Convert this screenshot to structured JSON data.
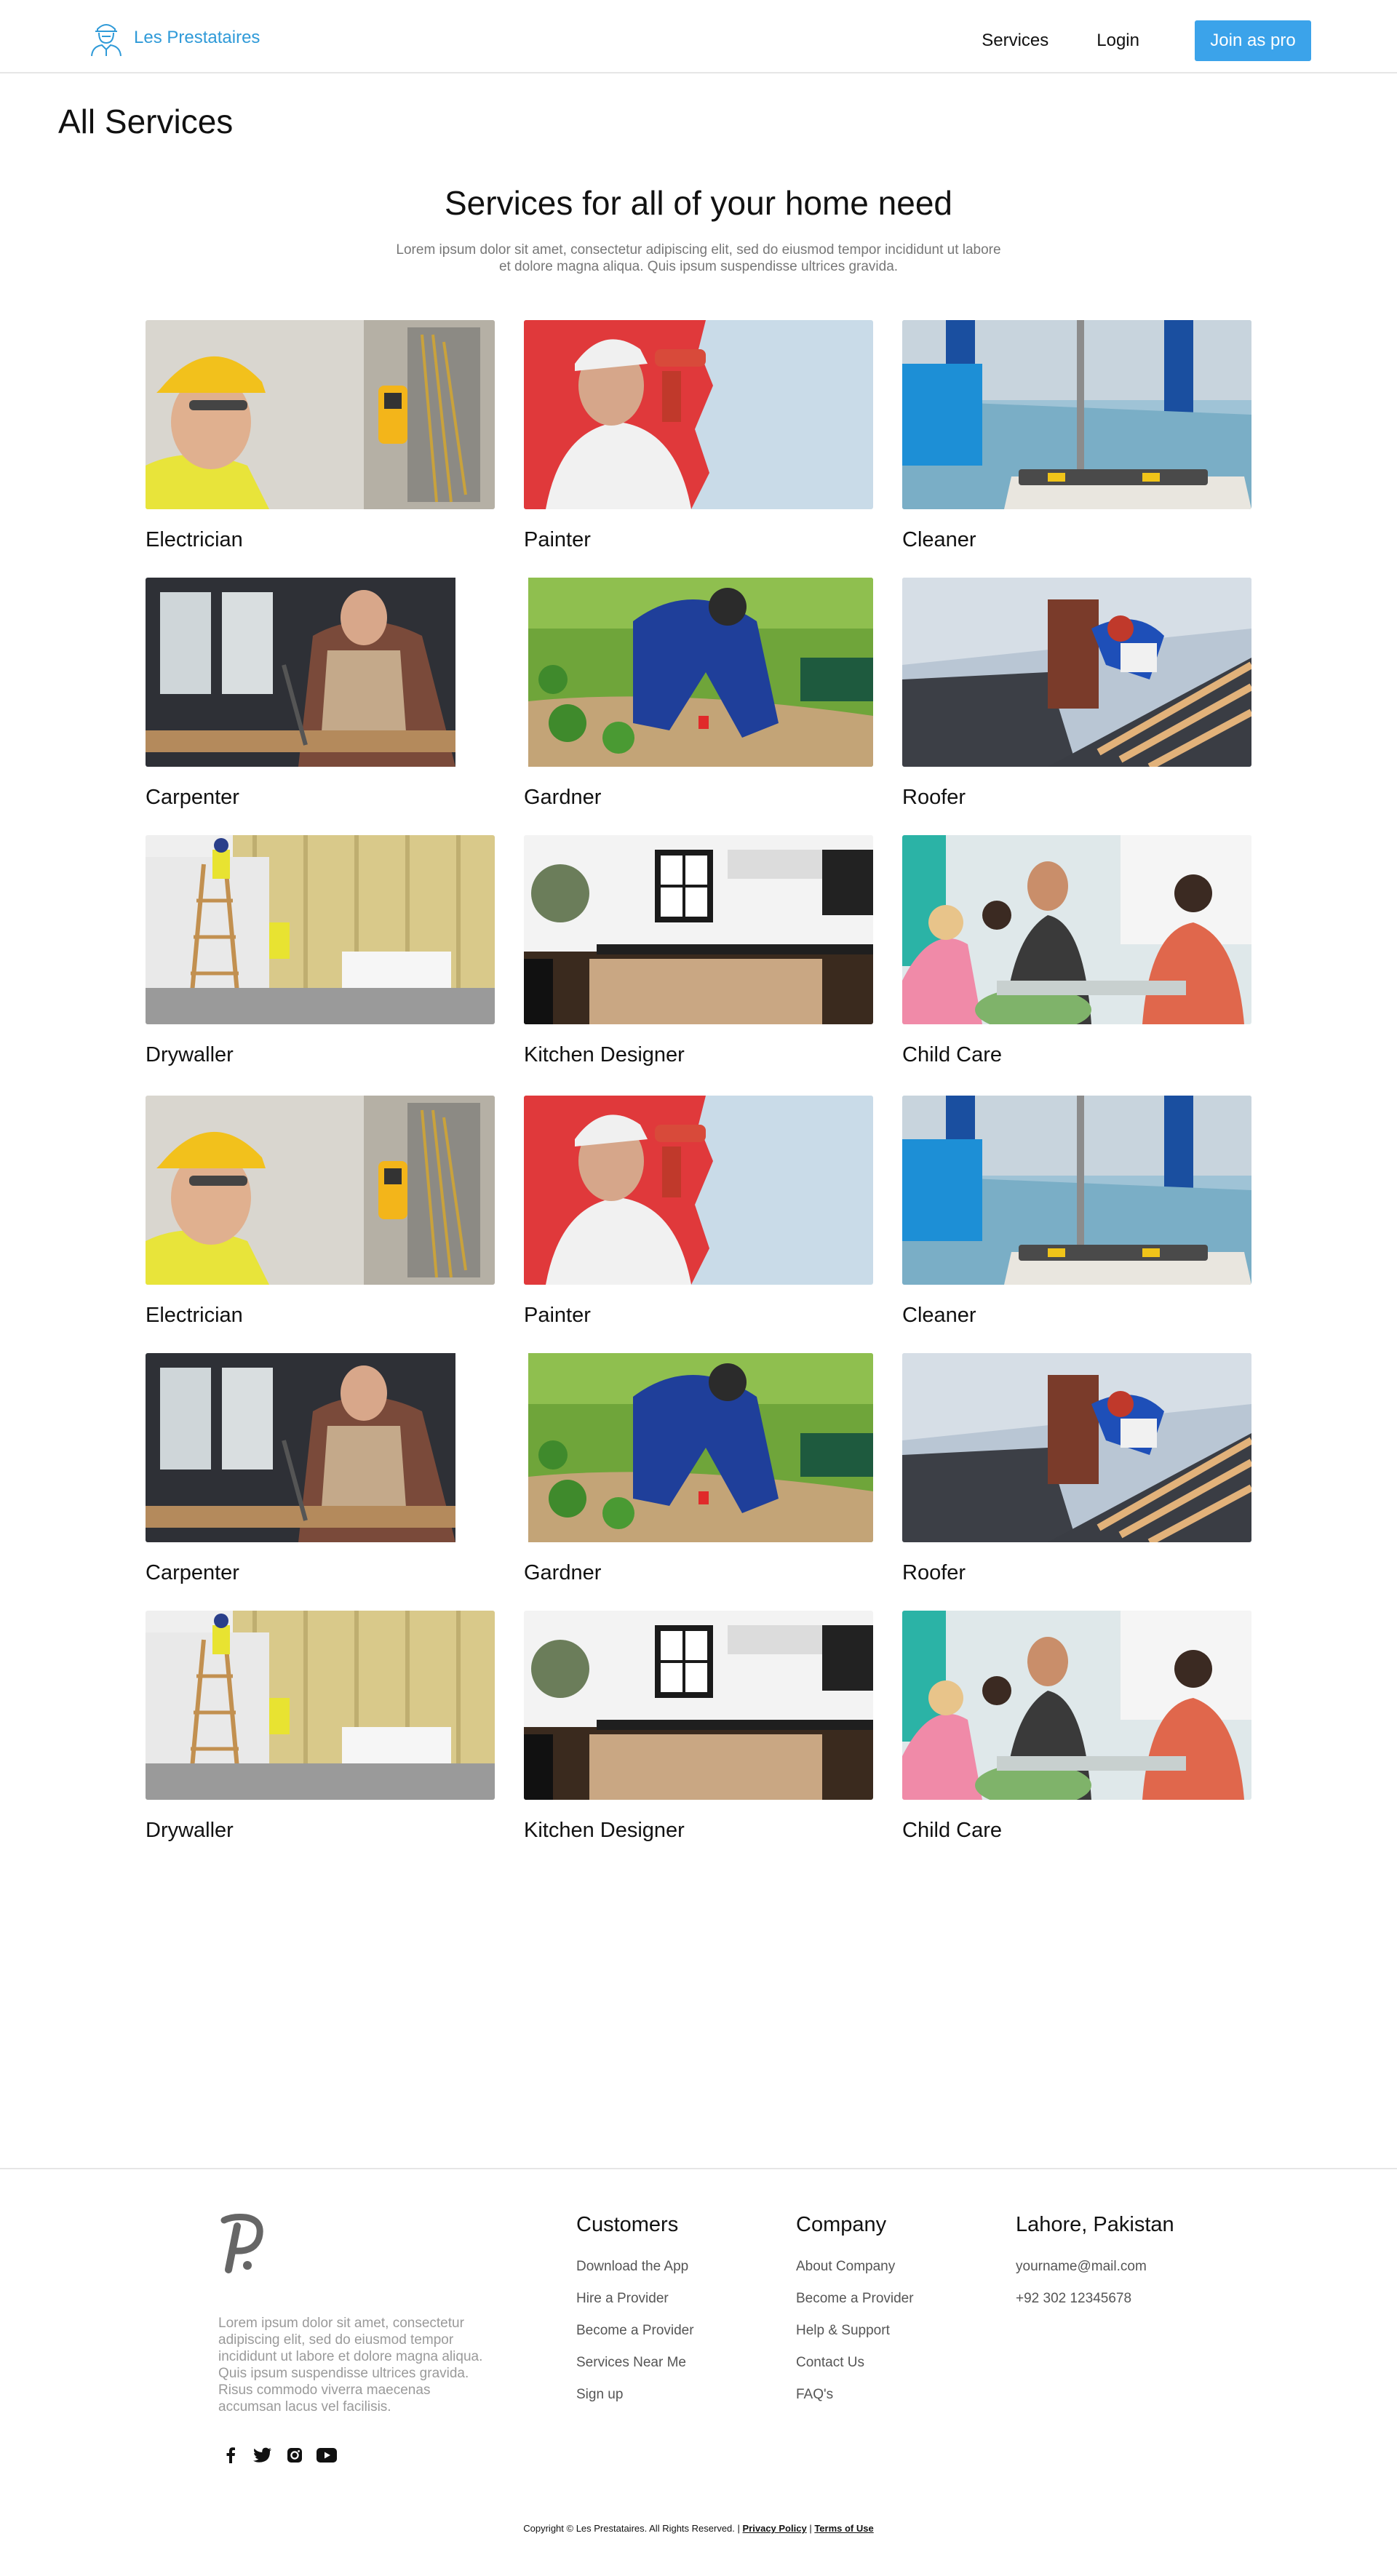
{
  "header": {
    "brand_name": "Les Prestataires",
    "nav": {
      "services": "Services",
      "login": "Login",
      "join": "Join as pro"
    }
  },
  "page_title": "All Services",
  "intro": {
    "title": "Services for all of your home need",
    "description": "Lorem ipsum dolor sit amet, consectetur adipiscing elit, sed do eiusmod tempor incididunt ut labore et dolore magna aliqua. Quis ipsum suspendisse ultrices gravida."
  },
  "services": [
    {
      "label": "Electrician",
      "image": "electrician-photo"
    },
    {
      "label": "Painter",
      "image": "painter-photo"
    },
    {
      "label": "Cleaner",
      "image": "cleaner-photo"
    },
    {
      "label": "Carpenter",
      "image": "carpenter-photo"
    },
    {
      "label": "Gardner",
      "image": "gardener-photo"
    },
    {
      "label": "Roofer",
      "image": "roofer-photo"
    },
    {
      "label": "Drywaller",
      "image": "drywaller-photo"
    },
    {
      "label": "Kitchen Designer",
      "image": "kitchen-photo"
    },
    {
      "label": "Child Care",
      "image": "childcare-photo"
    },
    {
      "label": "Electrician",
      "image": "electrician-photo"
    },
    {
      "label": "Painter",
      "image": "painter-photo"
    },
    {
      "label": "Cleaner",
      "image": "cleaner-photo"
    },
    {
      "label": "Carpenter",
      "image": "carpenter-photo"
    },
    {
      "label": "Gardner",
      "image": "gardener-photo"
    },
    {
      "label": "Roofer",
      "image": "roofer-photo"
    },
    {
      "label": "Drywaller",
      "image": "drywaller-photo"
    },
    {
      "label": "Kitchen Designer",
      "image": "kitchen-photo"
    },
    {
      "label": "Child Care",
      "image": "childcare-photo"
    }
  ],
  "footer": {
    "about": "Lorem ipsum dolor sit amet, consectetur adipiscing elit, sed do eiusmod tempor incididunt ut labore et dolore magna aliqua. Quis ipsum suspendisse ultrices gravida. Risus commodo viverra maecenas accumsan lacus vel facilisis.",
    "social": [
      "facebook-icon",
      "twitter-icon",
      "instagram-icon",
      "youtube-icon"
    ],
    "customers": {
      "title": "Customers",
      "links": [
        "Download the App",
        "Hire a Provider",
        "Become a Provider",
        "Services Near Me",
        "Sign up"
      ]
    },
    "company": {
      "title": "Company",
      "links": [
        "About Company",
        "Become a Provider",
        "Help & Support",
        "Contact Us",
        "FAQ's"
      ]
    },
    "location": {
      "title": "Lahore, Pakistan",
      "email": "yourname@mail.com",
      "phone": "+92 302 12345678"
    },
    "copyright": {
      "text": "Copyright © Les Prestataires. All Rights Reserved. |",
      "privacy": "Privacy Policy",
      "separator": "|",
      "terms": "Terms of Use"
    }
  },
  "colors": {
    "brand": "#2f9ad8",
    "button": "#3ba3ea",
    "muted_text": "#777777"
  }
}
